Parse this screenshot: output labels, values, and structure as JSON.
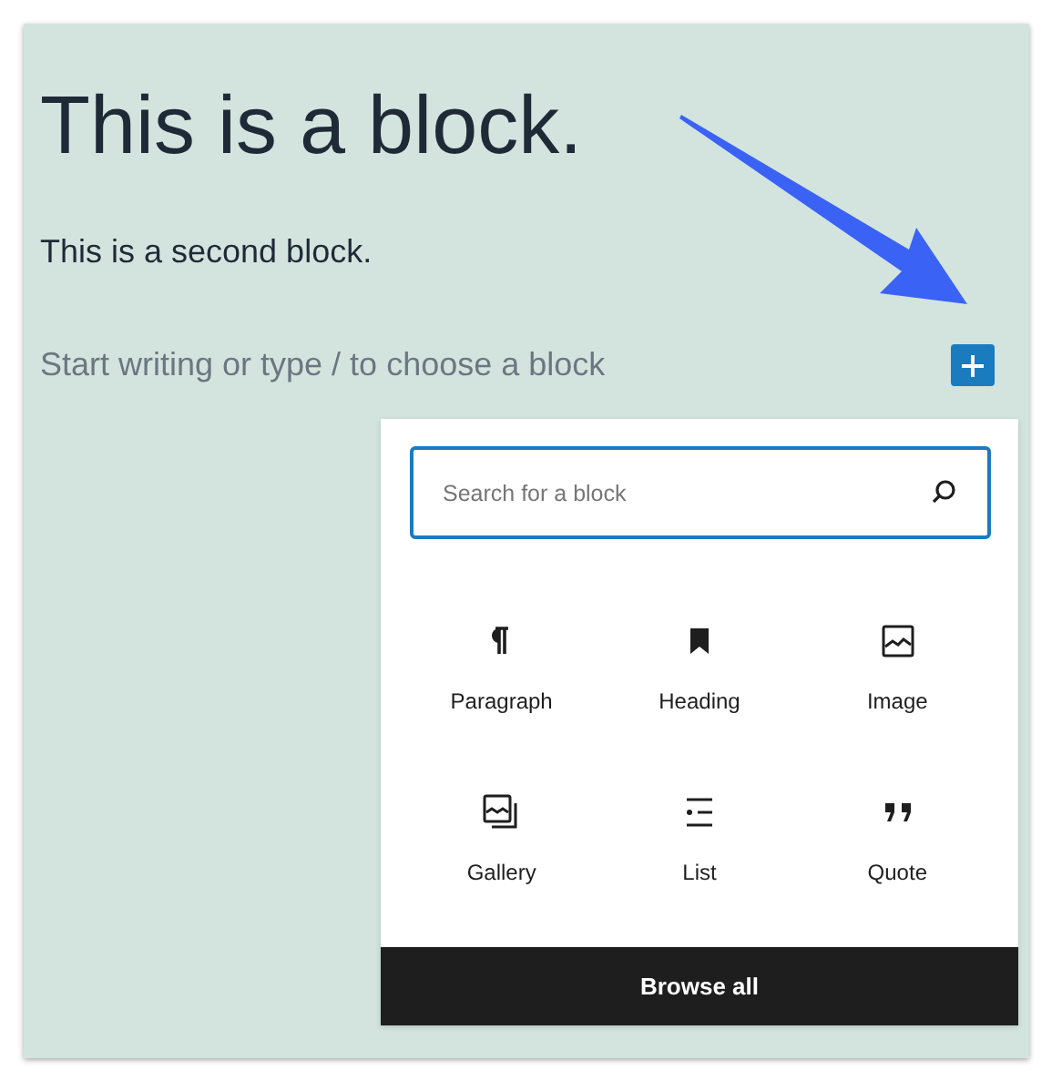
{
  "editor": {
    "blocks": [
      {
        "kind": "heading",
        "text": "This is a block."
      },
      {
        "kind": "paragraph",
        "text": "This is a second block."
      }
    ],
    "placeholder": "Start writing or type / to choose a block"
  },
  "inserter": {
    "search": {
      "placeholder": "Search for a block"
    },
    "items": [
      {
        "kind": "paragraph",
        "label": "Paragraph"
      },
      {
        "kind": "heading",
        "label": "Heading"
      },
      {
        "kind": "image",
        "label": "Image"
      },
      {
        "kind": "gallery",
        "label": "Gallery"
      },
      {
        "kind": "list",
        "label": "List"
      },
      {
        "kind": "quote",
        "label": "Quote"
      }
    ],
    "footer_button": "Browse all"
  }
}
